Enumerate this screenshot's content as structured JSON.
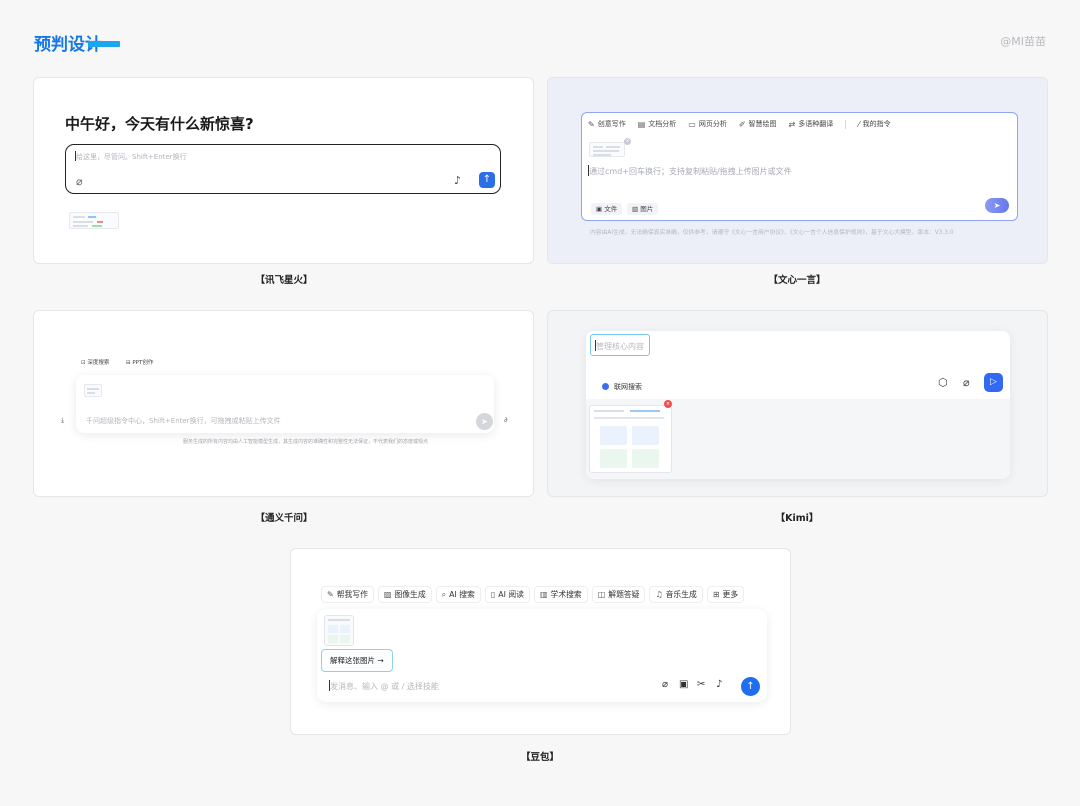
{
  "header": {
    "title": "预判设计",
    "watermark": "@MI苗苗"
  },
  "captions": {
    "xunfei": "【讯飞星火】",
    "wenxin": "【文心一言】",
    "tongyi": "【通义千问】",
    "kimi": "【Kimi】",
    "doubao": "【豆包】"
  },
  "xunfei": {
    "greeting": "中午好，今天有什么新惊喜?",
    "placeholder": "给这里，尽管问。Shift+Enter换行"
  },
  "wenxin": {
    "tools": [
      {
        "icon": "✎",
        "label": "创意写作"
      },
      {
        "icon": "▤",
        "label": "文档分析"
      },
      {
        "icon": "▭",
        "label": "网页分析"
      },
      {
        "icon": "✐",
        "label": "智慧绘图"
      },
      {
        "icon": "⇄",
        "label": "多语种翻译"
      }
    ],
    "my_command": {
      "icon": "⁄",
      "label": "我的指令"
    },
    "placeholder": "通过cmd+回车换行；支持复制粘贴/拖拽上传图片或文件",
    "file_chip": "文件",
    "image_chip": "图片",
    "footer": "内容由AI生成，无法确保真实准确，仅供参考，请遵守《文心一言用户协议》、《文心一言个人信息保护规则》，基于文心大模型，版本：V3.3.0"
  },
  "tongyi": {
    "tab_search": "深度搜索",
    "tab_ppt": "PPT创作",
    "placeholder": "千问超级指令中心，Shift+Enter换行，可拖拽或粘贴上传文件",
    "footer": "服务生成的所有内容均由人工智能模型生成，其生成内容的准确性和完整性无法保证，不代表我们的态度或观点"
  },
  "kimi": {
    "placeholder": "管理核心内容",
    "web_search": "联网搜索"
  },
  "doubao": {
    "tools": [
      {
        "icon": "✎",
        "label": "帮我写作"
      },
      {
        "icon": "▨",
        "label": "图像生成"
      },
      {
        "icon": "⌕",
        "label": "AI 搜索"
      },
      {
        "icon": "▯",
        "label": "AI 阅读"
      },
      {
        "icon": "▥",
        "label": "学术搜索"
      },
      {
        "icon": "◫",
        "label": "解题答疑"
      },
      {
        "icon": "♫",
        "label": "音乐生成"
      },
      {
        "icon": "⊞",
        "label": "更多"
      }
    ],
    "explain": "解释这张图片 →",
    "placeholder": "发消息、输入 @ 或 / 选择技能"
  }
}
